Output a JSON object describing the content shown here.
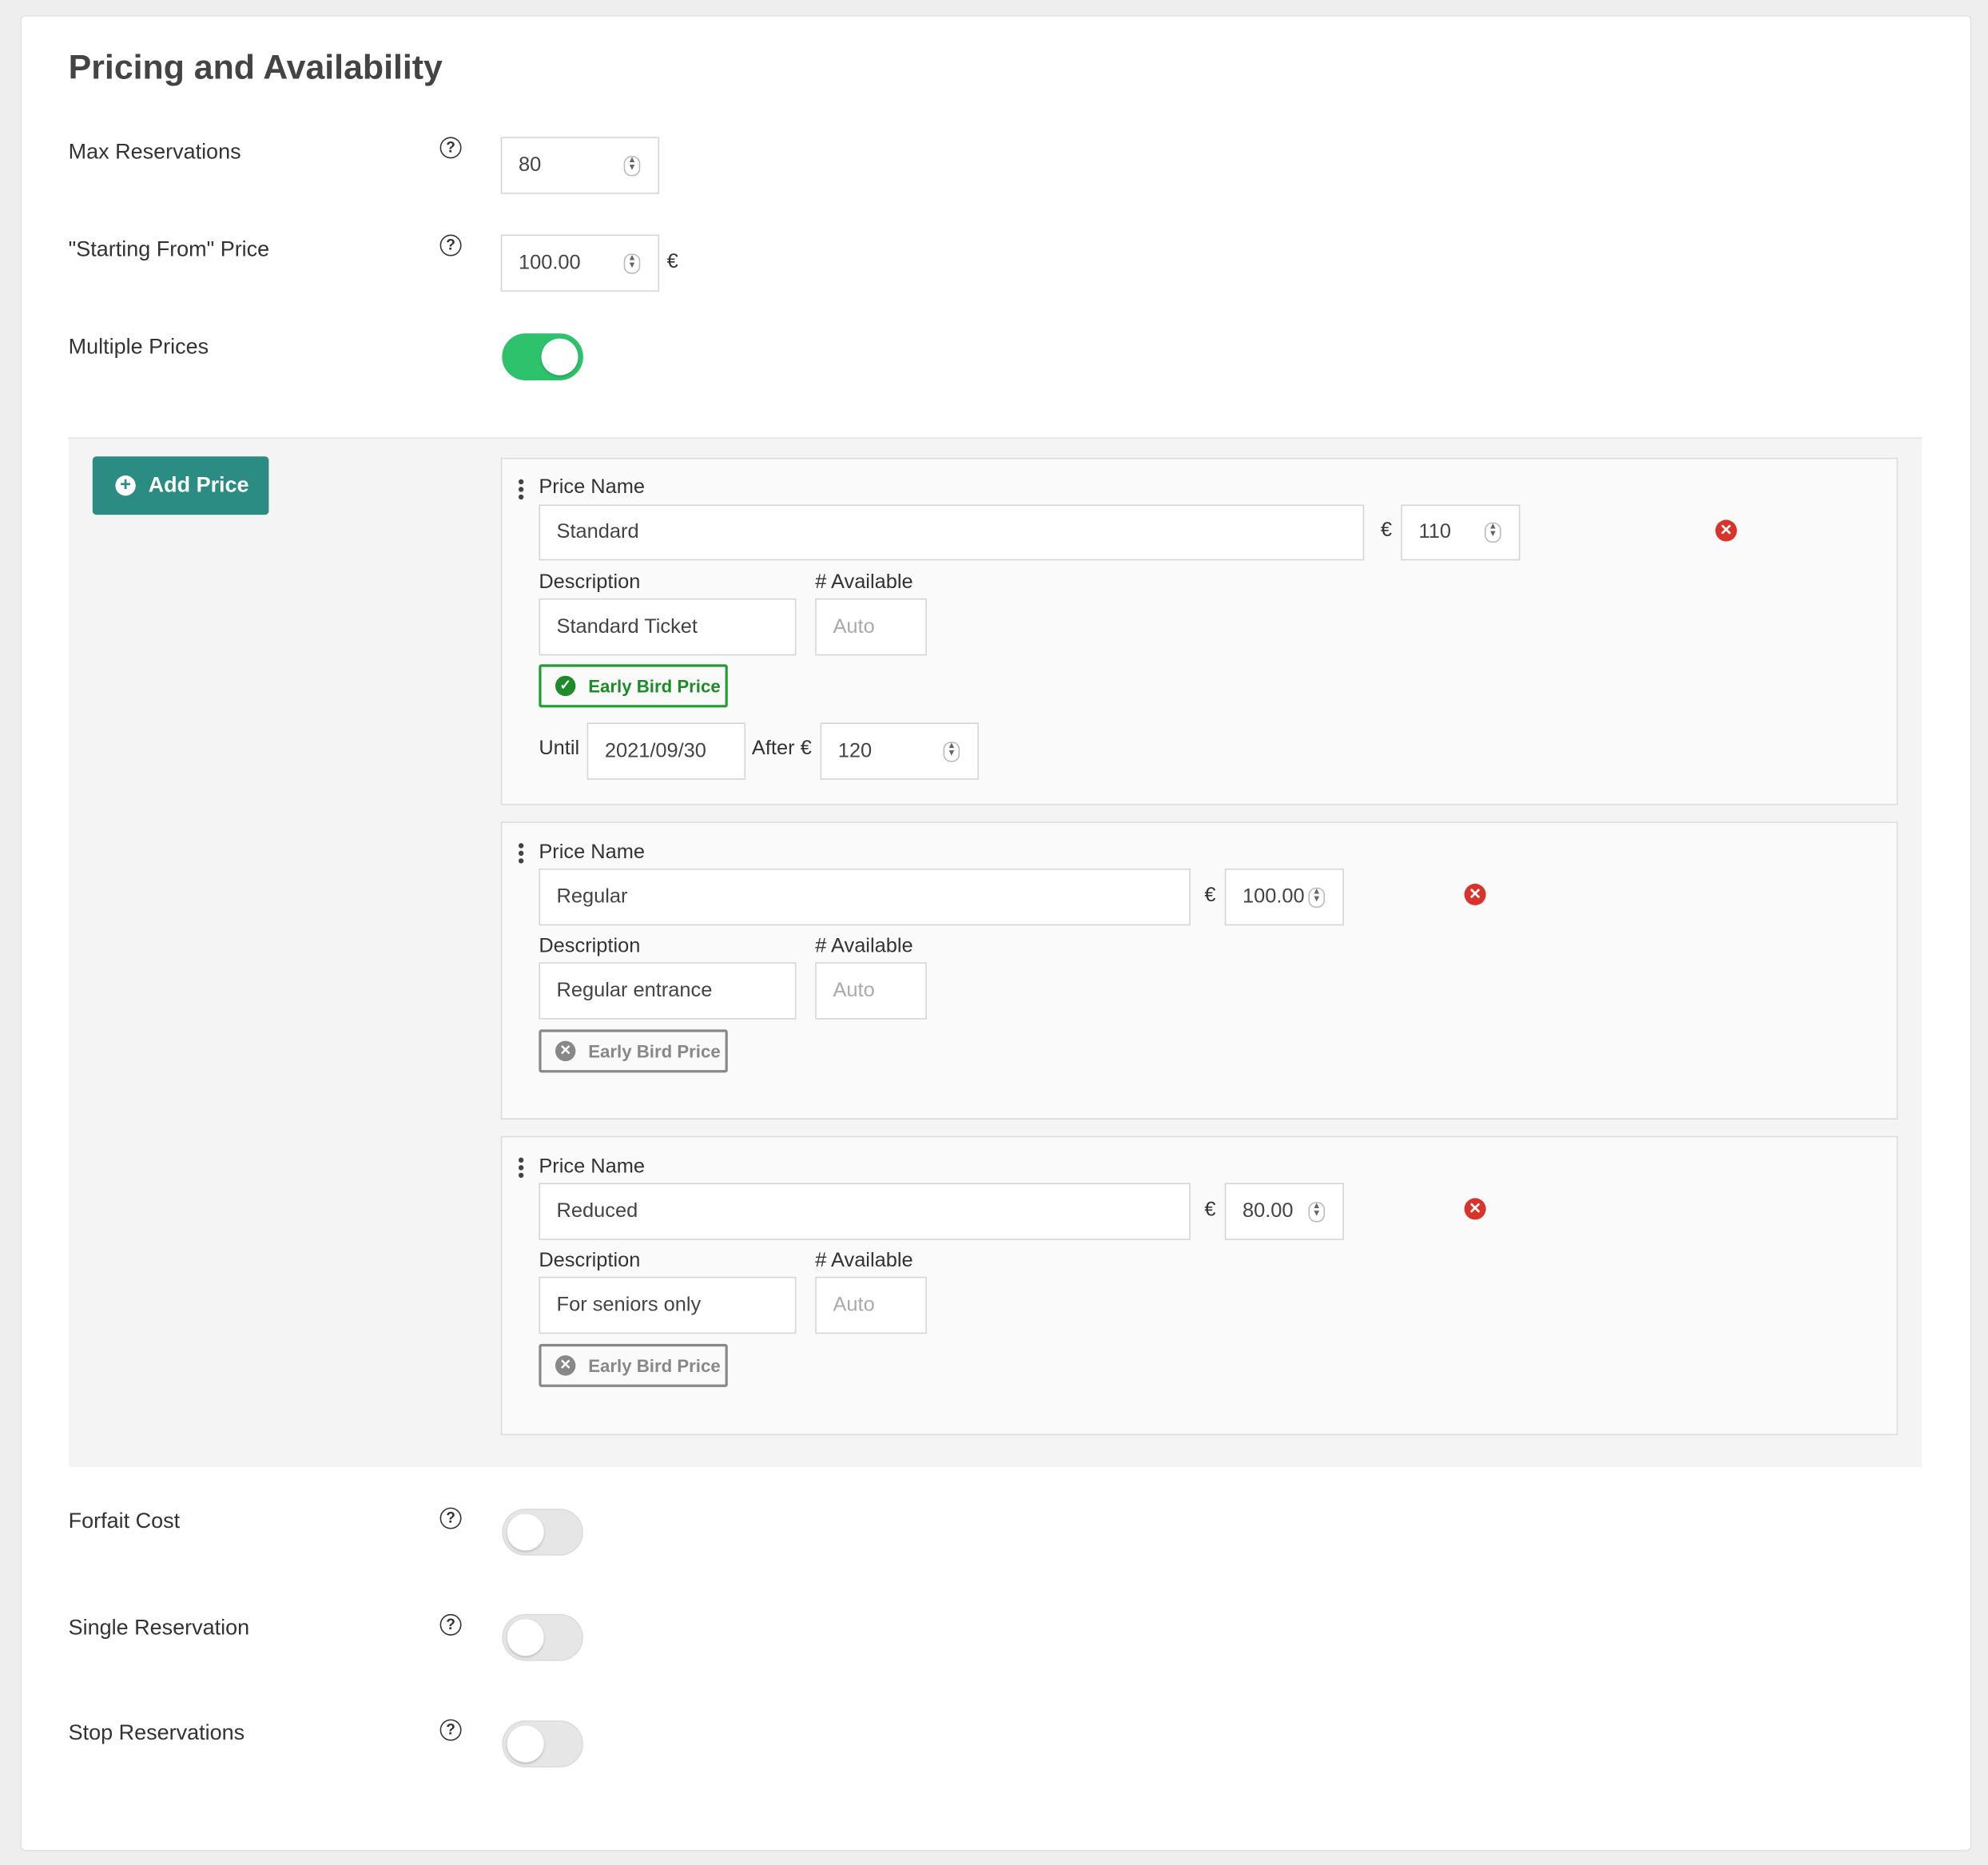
{
  "section_title": "Pricing and Availability",
  "max_reservations": {
    "label": "Max Reservations",
    "value": "80"
  },
  "starting_price": {
    "label": "\"Starting From\" Price",
    "value": "100.00",
    "currency": "€"
  },
  "multiple_prices": {
    "label": "Multiple Prices",
    "enabled": true
  },
  "add_price_label": "Add Price",
  "currency_symbol": "€",
  "prices": [
    {
      "name_label": "Price Name",
      "name": "Standard",
      "amount": "110",
      "description_label": "Description",
      "description": "Standard Ticket",
      "available_label": "# Available",
      "available_placeholder": "Auto",
      "early_bird_label": "Early Bird Price",
      "early_bird_enabled": true,
      "until_label": "Until",
      "until_date": "2021/09/30",
      "after_label": "After €",
      "after_amount": "120"
    },
    {
      "name_label": "Price Name",
      "name": "Regular",
      "amount": "100.00",
      "description_label": "Description",
      "description": "Regular entrance",
      "available_label": "# Available",
      "available_placeholder": "Auto",
      "early_bird_label": "Early Bird Price",
      "early_bird_enabled": false
    },
    {
      "name_label": "Price Name",
      "name": "Reduced",
      "amount": "80.00",
      "description_label": "Description",
      "description": "For seniors only",
      "available_label": "# Available",
      "available_placeholder": "Auto",
      "early_bird_label": "Early Bird Price",
      "early_bird_enabled": false
    }
  ],
  "forfait_cost": {
    "label": "Forfait Cost",
    "enabled": false
  },
  "single_reservation": {
    "label": "Single Reservation",
    "enabled": false
  },
  "stop_reservations": {
    "label": "Stop Reservations",
    "enabled": false
  },
  "colors": {
    "accent": "#2a8c82",
    "toggle_on": "#2dc26b",
    "delete": "#d9342b",
    "early_bird_on": "#1e8a28"
  }
}
